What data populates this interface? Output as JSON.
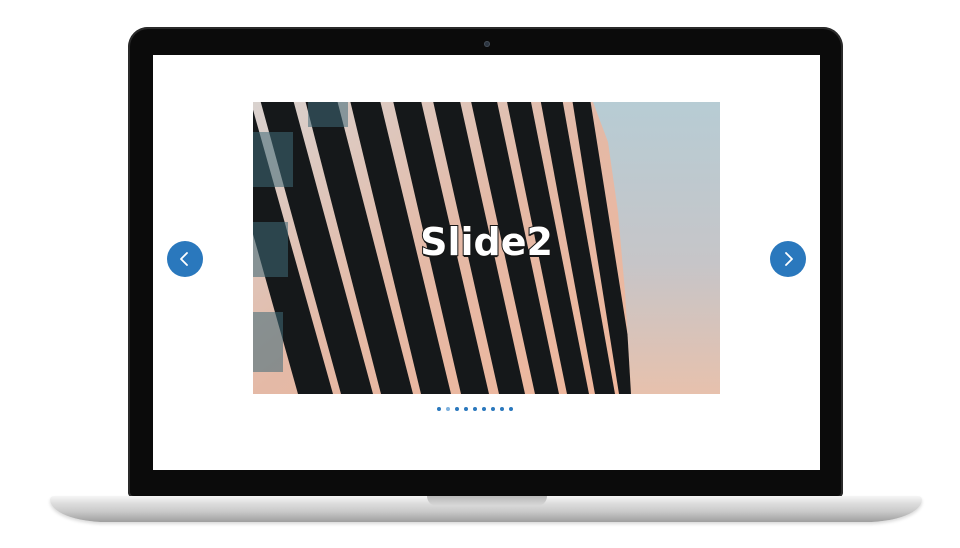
{
  "slider": {
    "current_slide_title": "Slide2",
    "slide_count": 9,
    "active_index": 1,
    "prev_icon": "chevron-left-icon",
    "next_icon": "chevron-right-icon",
    "accent_color": "#2a78bd",
    "active_dot_color": "#7fb2de"
  }
}
